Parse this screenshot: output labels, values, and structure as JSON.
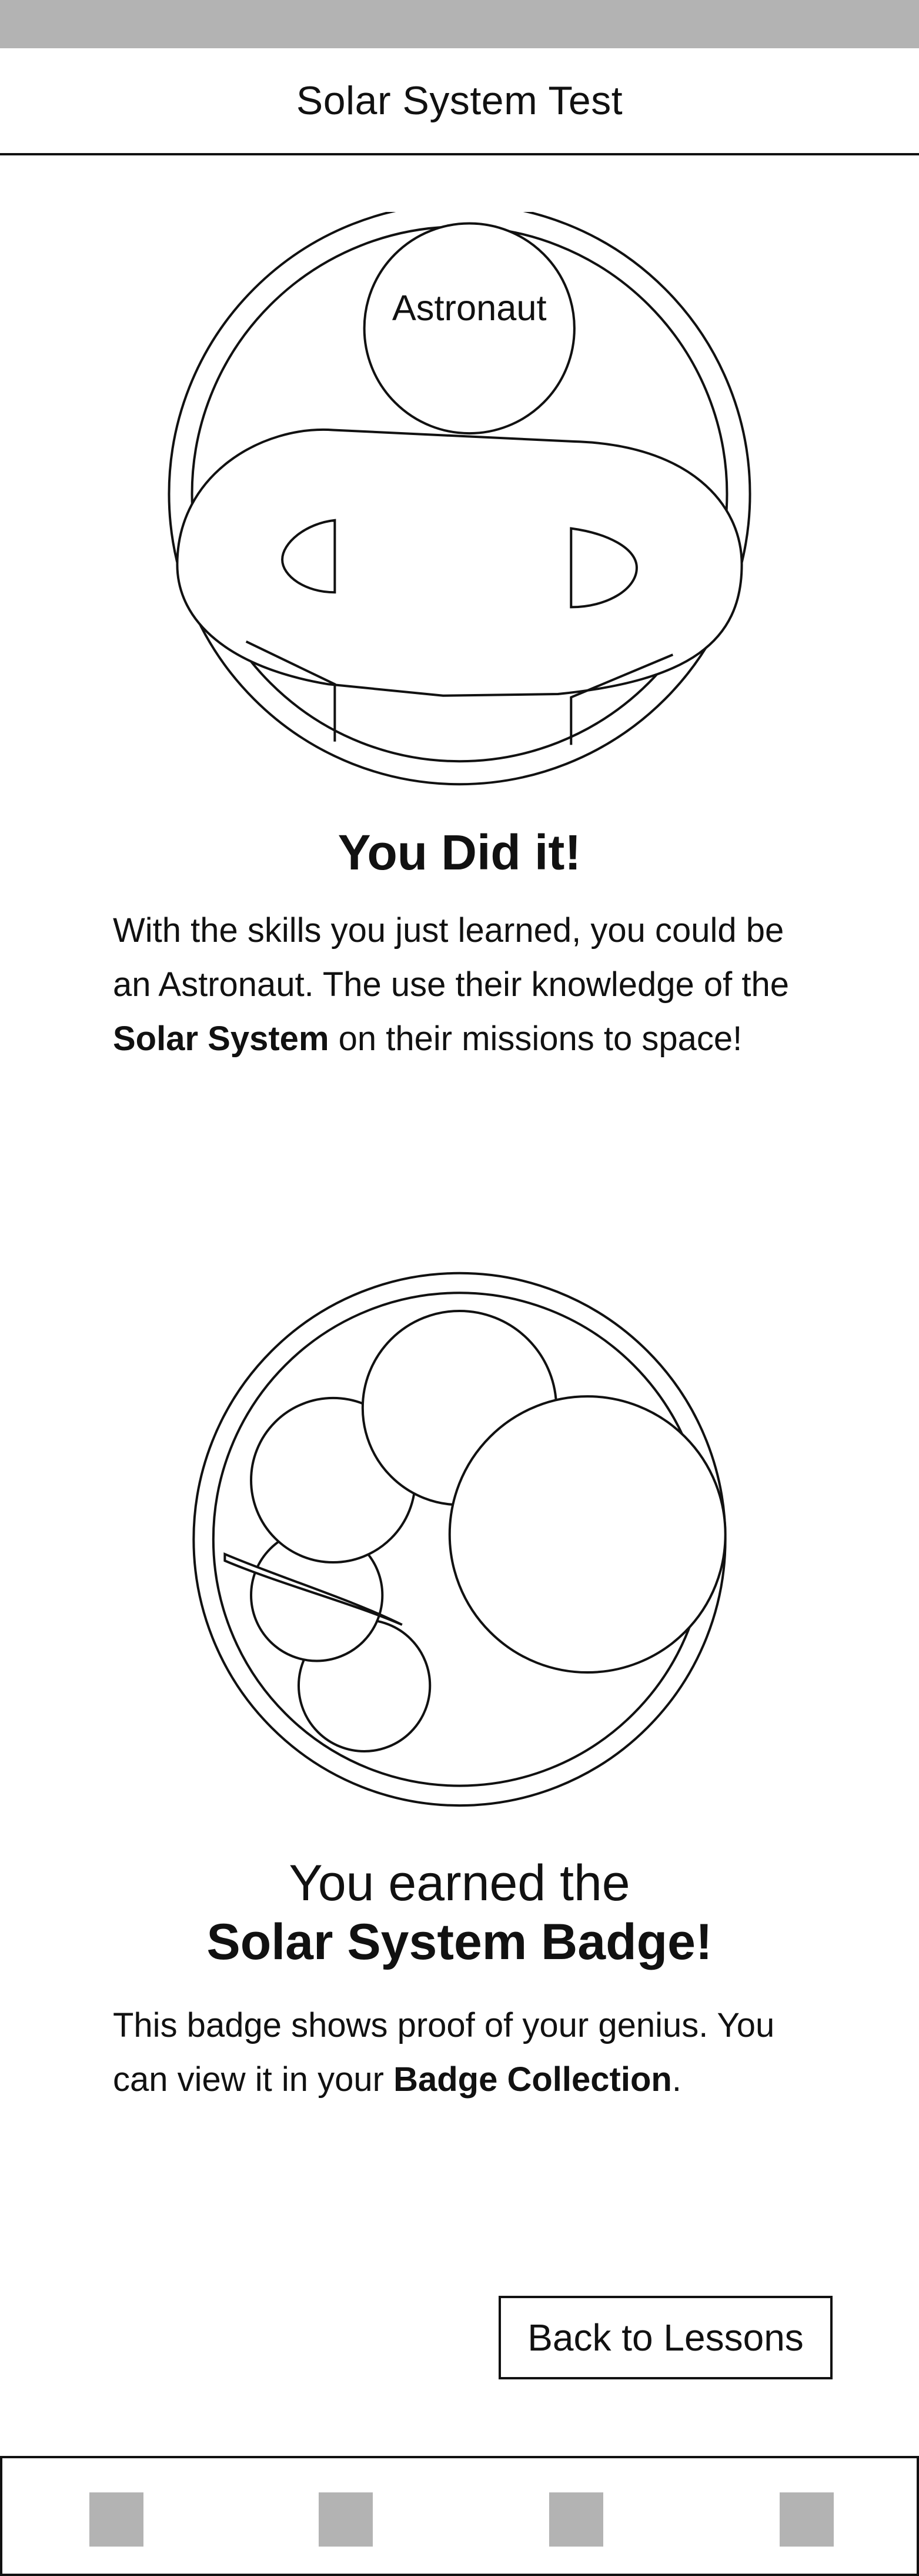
{
  "header": {
    "title": "Solar System Test"
  },
  "astronaut": {
    "helmet_label": "Astronaut"
  },
  "success": {
    "title": "You Did it!",
    "text_1": "With the skills you just learned, you could be an Astronaut. The use their knowledge of the ",
    "text_bold": "Solar System",
    "text_2": " on their missions to space!"
  },
  "badge": {
    "line_1": "You earned the",
    "line_2": "Solar System Badge!",
    "text_1": "This badge shows proof of your genius. You can view it in your ",
    "text_bold": "Badge Collection",
    "text_2": "."
  },
  "actions": {
    "back_label": "Back to Lessons"
  },
  "bottom_nav": {
    "items": [
      {
        "icon": "placeholder-square-icon"
      },
      {
        "icon": "placeholder-square-icon"
      },
      {
        "icon": "placeholder-square-icon"
      },
      {
        "icon": "placeholder-square-icon"
      }
    ]
  },
  "colors": {
    "placeholder_gray": "#b3b3b3",
    "stroke": "#111111",
    "background": "#ffffff"
  }
}
